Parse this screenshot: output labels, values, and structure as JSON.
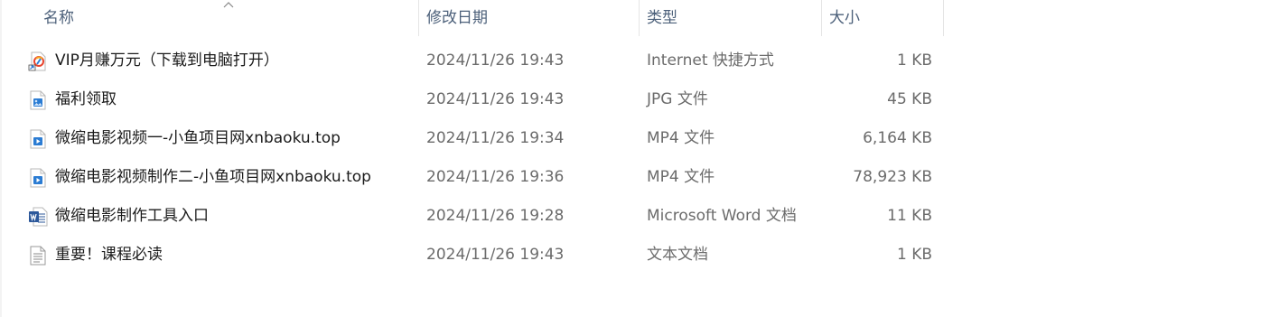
{
  "columns": {
    "name": "名称",
    "date": "修改日期",
    "type": "类型",
    "size": "大小"
  },
  "sort": {
    "column": "name",
    "direction": "ascending",
    "icon": "chevron-up-icon"
  },
  "files": [
    {
      "name": "VIP月赚万元（下载到电脑打开）",
      "date": "2024/11/26 19:43",
      "type": "Internet 快捷方式",
      "size": "1 KB",
      "icon": "internet-shortcut-icon"
    },
    {
      "name": "福利领取",
      "date": "2024/11/26 19:43",
      "type": "JPG 文件",
      "size": "45 KB",
      "icon": "image-file-icon"
    },
    {
      "name": "微缩电影视频一-小鱼项目网xnbaoku.top",
      "date": "2024/11/26 19:34",
      "type": "MP4 文件",
      "size": "6,164 KB",
      "icon": "video-file-icon"
    },
    {
      "name": "微缩电影视频制作二-小鱼项目网xnbaoku.top",
      "date": "2024/11/26 19:36",
      "type": "MP4 文件",
      "size": "78,923 KB",
      "icon": "video-file-icon"
    },
    {
      "name": "微缩电影制作工具入口",
      "date": "2024/11/26 19:28",
      "type": "Microsoft Word 文档",
      "size": "11 KB",
      "icon": "word-document-icon"
    },
    {
      "name": "重要！课程必读",
      "date": "2024/11/26 19:43",
      "type": "文本文档",
      "size": "1 KB",
      "icon": "text-document-icon"
    }
  ],
  "colors": {
    "header_text": "#4c607a",
    "name_text": "#1b1b1b",
    "meta_text": "#6b6b6b",
    "divider": "#e5e5e5"
  }
}
